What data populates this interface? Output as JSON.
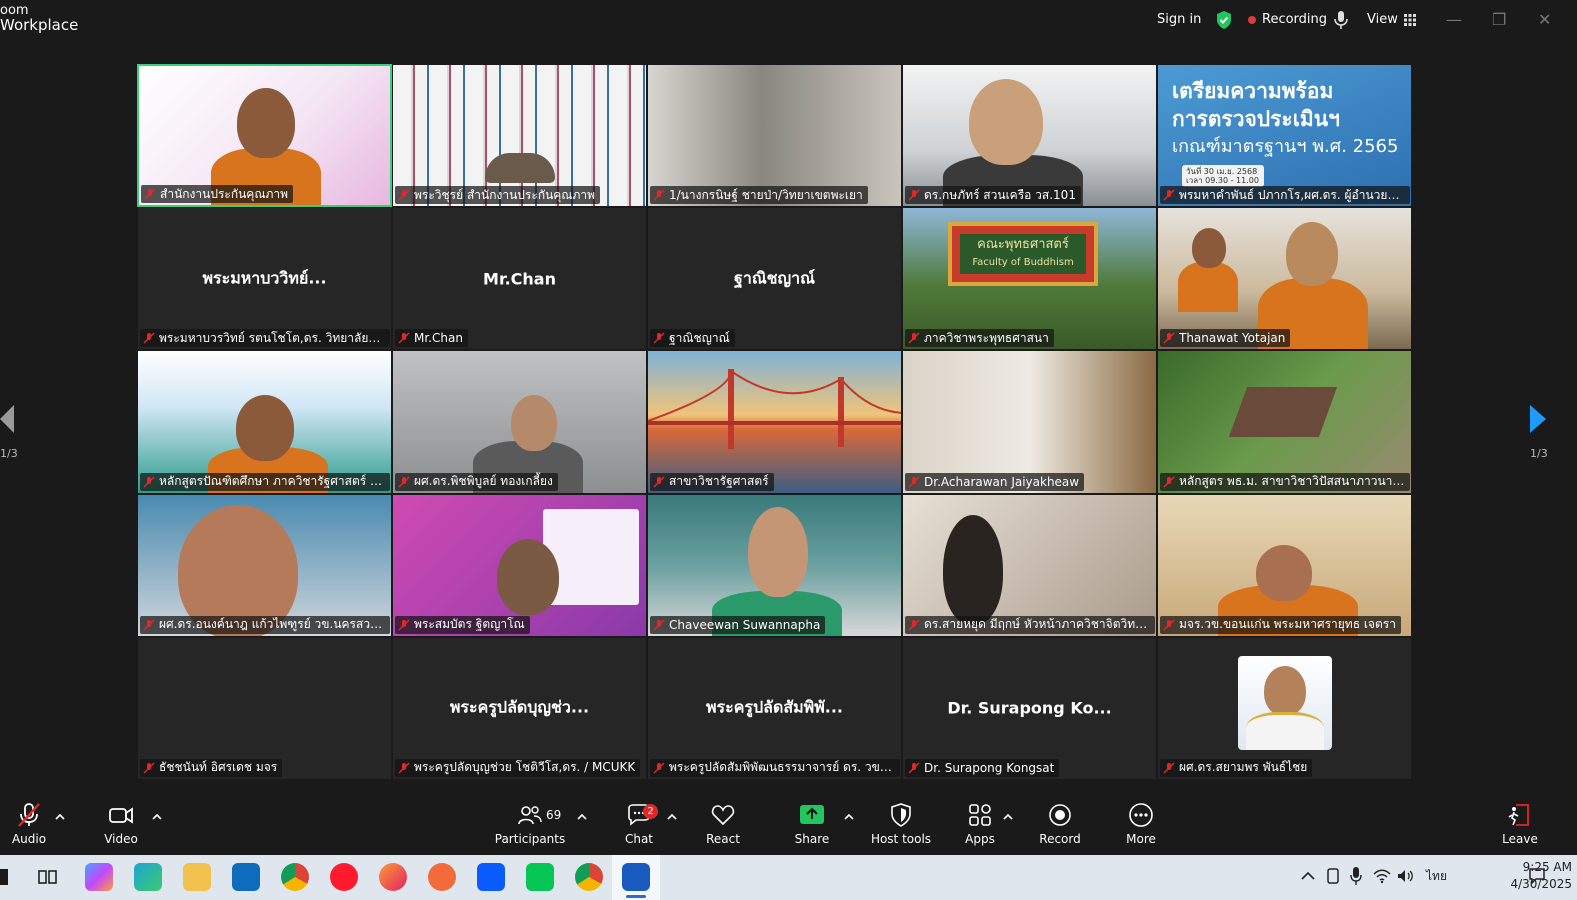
{
  "app": {
    "brand_line1": "oom",
    "brand_line2": "Workplace"
  },
  "titlebar": {
    "sign_in": "Sign in",
    "recording": "Recording",
    "view": "View",
    "minimize": "—",
    "restore": "❐",
    "close": "✕"
  },
  "colors": {
    "accent": "#1f9bff",
    "active_speaker": "#3ad07a",
    "recording_dot": "#e03a3a",
    "share_green": "#22c55e",
    "muted_red": "#e02828"
  },
  "pagination": {
    "left": "1/3",
    "right": "1/3"
  },
  "tiles": [
    {
      "name": "สำนักงานประกันคุณภาพ",
      "center": ""
    },
    {
      "name": "พระวิชุรย์ สำนักงานประกันคุณภาพ",
      "center": ""
    },
    {
      "name": "1/นางกรนิษฐ์ ชายป่า/วิทยาเขตพะเยา",
      "center": ""
    },
    {
      "name": "ดร.กษภัทร์ สวนเครือ วส.101",
      "center": ""
    },
    {
      "name": "พรมหาคำพันธ์ ปภากโร,ผศ.ดร. ผู้อำนวยการ...",
      "center": ""
    },
    {
      "name": "พระมหาบวรวิทย์ รตนโชโต,ดร. วิทยาลัยสงฆ์น...",
      "center": "พระมหาบววิทย์..."
    },
    {
      "name": "Mr.Chan",
      "center": "Mr.Chan"
    },
    {
      "name": "ฐาณิชญาณ์",
      "center": "ฐาณิชญาณ์"
    },
    {
      "name": "ภาควิชาพระพุทธศาสนา",
      "center": ""
    },
    {
      "name": "Thanawat Yotajan",
      "center": ""
    },
    {
      "name": "หลักสูตรปัณฑิตศึกษา ภาควิชารัฐศาสตร์ คณะ...",
      "center": ""
    },
    {
      "name": "ผศ.ดร.พิชพิบูลย์ ทองเกลี้ยง",
      "center": ""
    },
    {
      "name": "สาขาวิชารัฐศาสตร์",
      "center": ""
    },
    {
      "name": "Dr.Acharawan Jaiyakheaw",
      "center": ""
    },
    {
      "name": "หลักสูตร พธ.ม. สาขาวิชาวิปัสสนาภาวนาศึกษา",
      "center": ""
    },
    {
      "name": "ผศ.ดร.อนงค์นาฎ แก้วไพฑูรย์ วข.นครสวรรค์",
      "center": ""
    },
    {
      "name": "พระสมบัตร ฐิตญาโณ",
      "center": ""
    },
    {
      "name": "Chaveewan Suwannapha",
      "center": ""
    },
    {
      "name": "ดร.สายหยุด มีฤกษ์ หัวหน้าภาควิชาจิตวิทยาก...",
      "center": ""
    },
    {
      "name": "มจร.วข.ขอนแก่น พระมหาศรายุทธ เจตรา",
      "center": ""
    },
    {
      "name": "ธัชชนันท์ อิศรเดช มจร",
      "center": ""
    },
    {
      "name": "พระครูปลัดบุญช่วย โชติวีโส,ดร. / MCUKK",
      "center": "พระครูปลัดบุญช่ว..."
    },
    {
      "name": "พระครูปลัดสัมพิพัฒนธรรมาจารย์ ดร. วข.บา...",
      "center": "พระครูปลัดสัมพิพั..."
    },
    {
      "name": "Dr. Surapong Kongsat",
      "center": "Dr. Surapong Ko..."
    },
    {
      "name": "ผศ.ดร.สยามพร พันธ์ไชย",
      "center": ""
    }
  ],
  "poster": {
    "line1": "เตรียมความพร้อม",
    "line2": "การตรวจประเมินฯ",
    "line3": "เกณฑ์มาตรฐานฯ พ.ศ. 2565",
    "date1": "วันที่ 30 เม.ย. 2568",
    "date2": "เวลา 09.30 - 11.00 น."
  },
  "faculty_sign": {
    "thai": "คณะพุทธศาสตร์",
    "english": "Faculty of Buddhism"
  },
  "toolbar": {
    "audio": "Audio",
    "video": "Video",
    "participants": "Participants",
    "participants_count": "69",
    "chat": "Chat",
    "chat_badge": "2",
    "react": "React",
    "share": "Share",
    "host_tools": "Host tools",
    "apps": "Apps",
    "record": "Record",
    "more": "More",
    "leave": "Leave"
  },
  "taskbar": {
    "language": "ไทย",
    "time": "9:25 AM",
    "date": "4/30/2025"
  }
}
